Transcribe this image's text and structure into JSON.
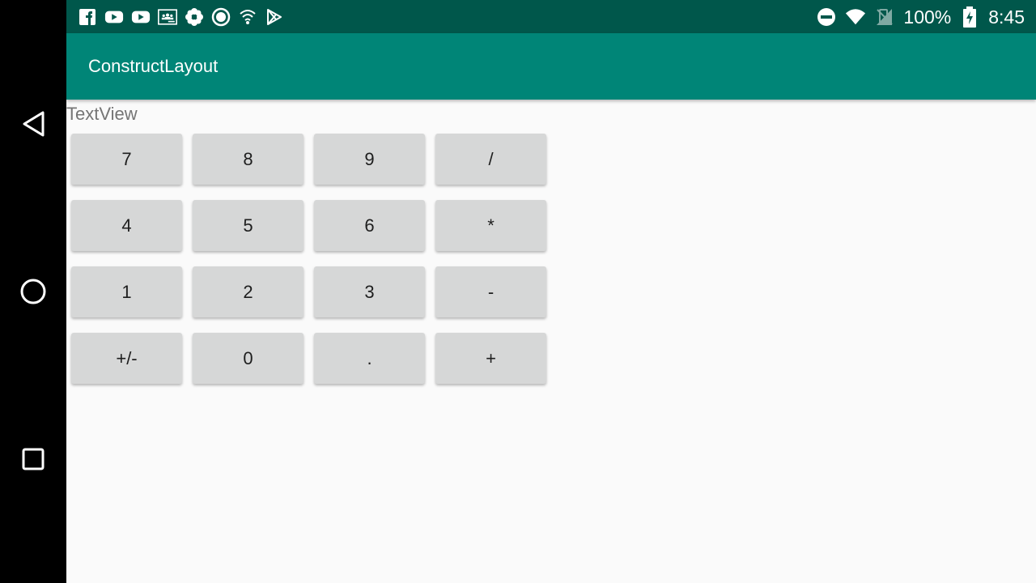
{
  "statusbar": {
    "notification_icons": [
      "facebook-icon",
      "youtube-icon",
      "youtube-icon",
      "classroom-icon",
      "flower-icon",
      "circle-app-icon",
      "wifi-lock-icon",
      "play-store-icon"
    ],
    "battery": "100%",
    "time": "8:45"
  },
  "appbar": {
    "title": "ConstructLayout"
  },
  "textview": "TextView",
  "keys": [
    "7",
    "8",
    "9",
    "/",
    "4",
    "5",
    "6",
    "*",
    "1",
    "2",
    "3",
    "-",
    "+/-",
    "0",
    ".",
    "+"
  ],
  "colors": {
    "statusbar": "#00574b",
    "appbar": "#008577",
    "background": "#fafafa",
    "button": "#d6d7d7"
  }
}
